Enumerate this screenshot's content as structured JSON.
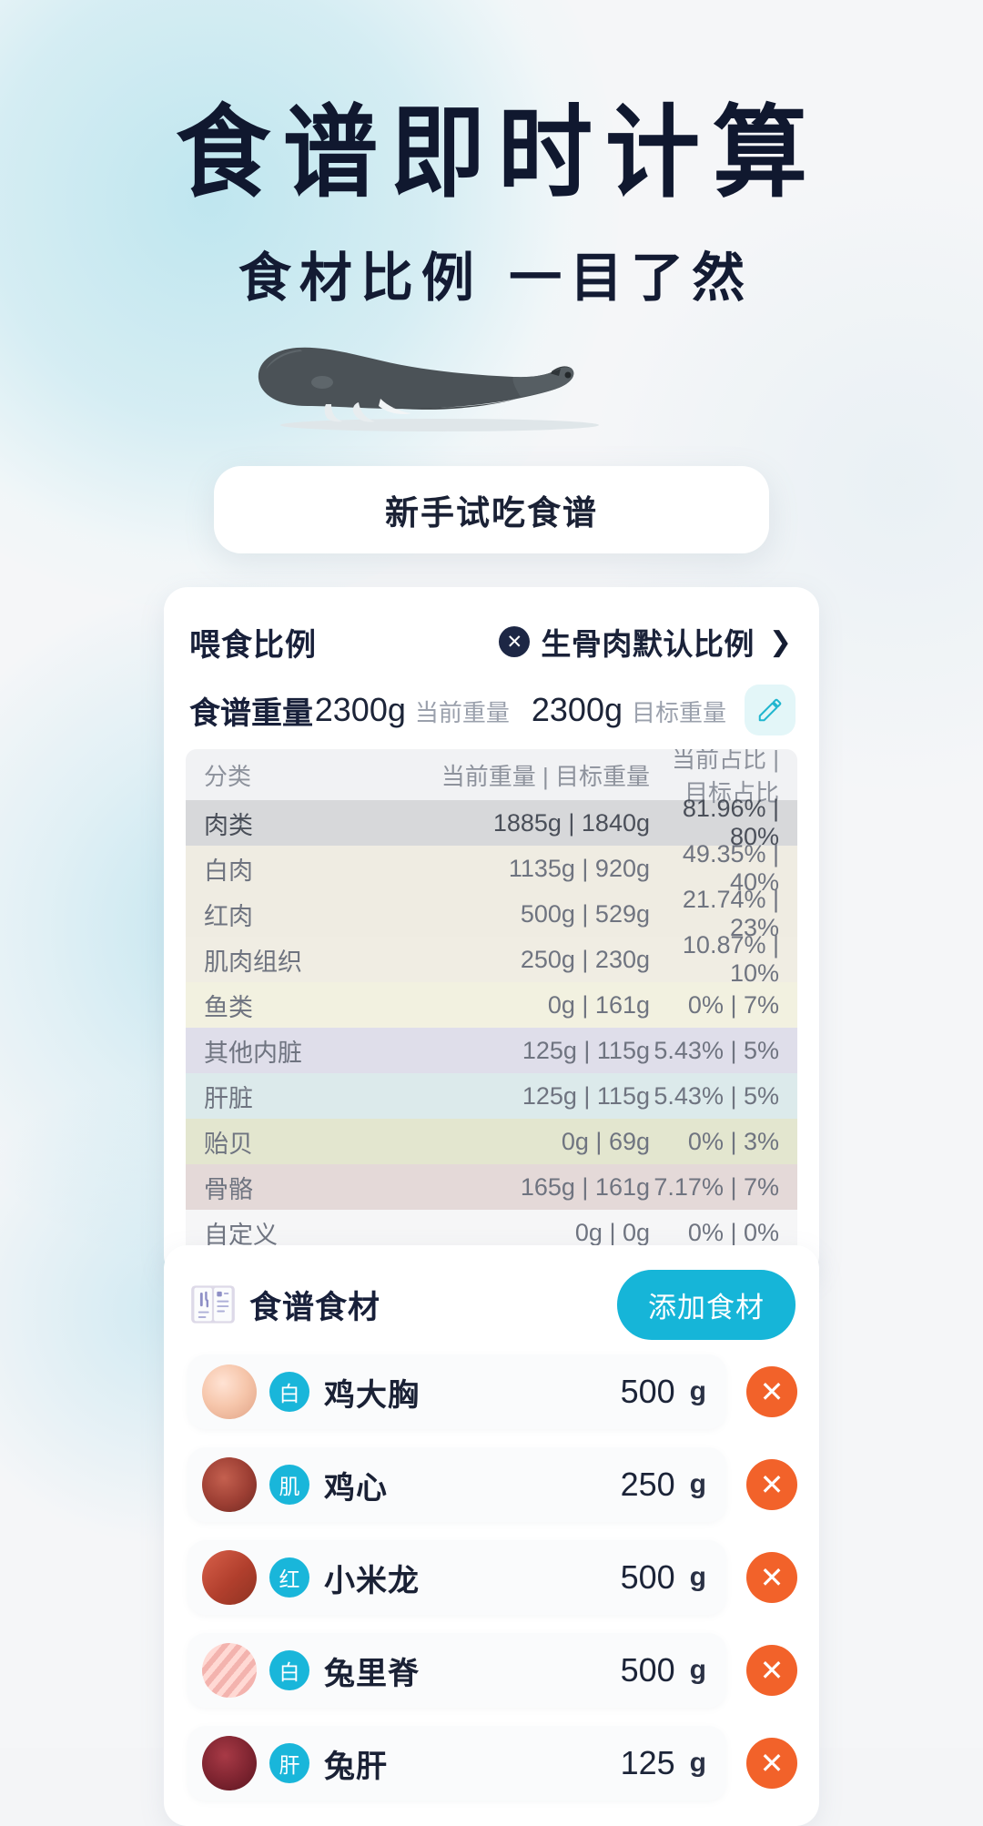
{
  "hero": {
    "title": "食谱即时计算",
    "subtitle": "食材比例 一目了然",
    "dog_illustration": "sleeping-dog"
  },
  "cta": {
    "label": "新手试吃食谱"
  },
  "ratio_card": {
    "title": "喂食比例",
    "preset_label": "生骨肉默认比例",
    "preset_icon": "x-circle-icon",
    "chevron": "❯",
    "weight_label": "食谱重量",
    "current_weight": "2300g",
    "current_weight_caption": "当前重量",
    "target_weight": "2300g",
    "target_weight_caption": "目标重量",
    "edit_icon": "pencil-icon",
    "table": {
      "headers": [
        "分类",
        "当前重量 | 目标重量",
        "当前占比 | 目标占比"
      ],
      "rows": [
        {
          "name": "肉类",
          "weight": "1885g | 1840g",
          "pct": "81.96% | 80%",
          "bg": "#d7d8da",
          "major": true
        },
        {
          "name": "白肉",
          "weight": "1135g | 920g",
          "pct": "49.35% | 40%",
          "bg": "#efece2",
          "major": false
        },
        {
          "name": "红肉",
          "weight": "500g | 529g",
          "pct": "21.74% | 23%",
          "bg": "#efece2",
          "major": false
        },
        {
          "name": "肌肉组织",
          "weight": "250g | 230g",
          "pct": "10.87% | 10%",
          "bg": "#f0ede3",
          "major": false
        },
        {
          "name": "鱼类",
          "weight": "0g | 161g",
          "pct": "0% | 7%",
          "bg": "#f2f1e0",
          "major": false
        },
        {
          "name": "其他内脏",
          "weight": "125g | 115g",
          "pct": "5.43% | 5%",
          "bg": "#dfdeea",
          "major": false
        },
        {
          "name": "肝脏",
          "weight": "125g | 115g",
          "pct": "5.43% | 5%",
          "bg": "#dceaeb",
          "major": false
        },
        {
          "name": "贻贝",
          "weight": "0g | 69g",
          "pct": "0% | 3%",
          "bg": "#e3e6cf",
          "major": false
        },
        {
          "name": "骨骼",
          "weight": "165g | 161g",
          "pct": "7.17% | 7%",
          "bg": "#e4d9d8",
          "major": false
        },
        {
          "name": "自定义",
          "weight": "0g | 0g",
          "pct": "0% | 0%",
          "bg": "#f6f6f7",
          "major": false
        }
      ]
    }
  },
  "ingredients_card": {
    "icon": "recipe-book-icon",
    "title": "食谱食材",
    "add_button": "添加食材",
    "unit": "g",
    "delete_icon": "close-circle-icon",
    "rows": [
      {
        "tag": "白",
        "name": "鸡大胸",
        "amount": "500",
        "thumb": "chicken-breast"
      },
      {
        "tag": "肌",
        "name": "鸡心",
        "amount": "250",
        "thumb": "chicken-hearts"
      },
      {
        "tag": "红",
        "name": "小米龙",
        "amount": "500",
        "thumb": "beef-eye-round"
      },
      {
        "tag": "白",
        "name": "兔里脊",
        "amount": "500",
        "thumb": "rabbit-loin"
      },
      {
        "tag": "肝",
        "name": "兔肝",
        "amount": "125",
        "thumb": "rabbit-liver"
      }
    ]
  },
  "colors": {
    "accent": "#16b5d8",
    "delete": "#f2622a",
    "ink": "#18203a",
    "edit_bg": "#e3f6f8"
  }
}
